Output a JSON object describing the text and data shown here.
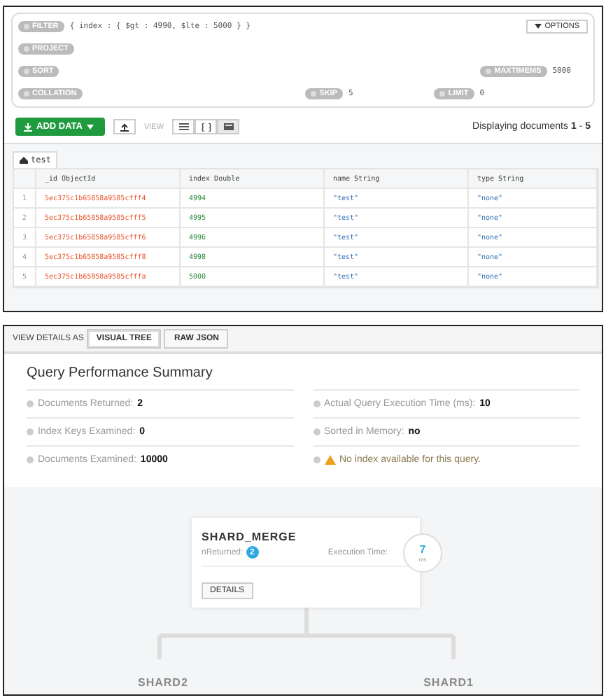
{
  "query": {
    "options": "OPTIONS",
    "filter": {
      "label": "FILTER",
      "value": "{ index : { $gt : 4990, $lte : 5000 } }"
    },
    "project": {
      "label": "PROJECT"
    },
    "sort": {
      "label": "SORT"
    },
    "maxtimems": {
      "label": "MAXTIMEMS",
      "value": "5000"
    },
    "collation": {
      "label": "COLLATION"
    },
    "skip": {
      "label": "SKIP",
      "value": "5"
    },
    "limit": {
      "label": "LIMIT",
      "value": "0"
    }
  },
  "toolbar": {
    "add": "ADD DATA",
    "view_label": "VIEW",
    "views": [
      {
        "kind": "list",
        "selected": false
      },
      {
        "kind": "json",
        "selected": false
      },
      {
        "kind": "table",
        "selected": true
      }
    ],
    "status": "Displaying documents **1** - **5**"
  },
  "tab": "test",
  "table": {
    "columns": [
      {
        "name": "_id",
        "type": "ObjectId",
        "kind": "objectid"
      },
      {
        "name": "index",
        "type": "Double",
        "kind": "number"
      },
      {
        "name": "name",
        "type": "String",
        "kind": "string"
      },
      {
        "name": "type",
        "type": "String",
        "kind": "string"
      }
    ],
    "rows": [
      {
        "n": "1",
        "cells": [
          "5ec375c1b65858a9585cfff4",
          "4994",
          "\"test\"",
          "\"none\""
        ]
      },
      {
        "n": "2",
        "cells": [
          "5ec375c1b65858a9585cfff5",
          "4995",
          "\"test\"",
          "\"none\""
        ]
      },
      {
        "n": "3",
        "cells": [
          "5ec375c1b65858a9585cfff6",
          "4996",
          "\"test\"",
          "\"none\""
        ]
      },
      {
        "n": "4",
        "cells": [
          "5ec375c1b65858a9585cfff8",
          "4998",
          "\"test\"",
          "\"none\""
        ]
      },
      {
        "n": "5",
        "cells": [
          "5ec375c1b65858a9585cfffa",
          "5000",
          "\"test\"",
          "\"none\""
        ]
      }
    ]
  },
  "view_details": {
    "label": "VIEW DETAILS AS",
    "tabs": [
      {
        "label": "VISUAL TREE",
        "selected": true
      },
      {
        "label": "RAW JSON",
        "selected": false
      }
    ]
  },
  "summary": {
    "title": "Query Performance Summary",
    "left": [
      {
        "kind": "stat",
        "label": "Documents Returned:",
        "value": "2"
      },
      {
        "kind": "stat",
        "label": "Index Keys Examined:",
        "value": "0"
      },
      {
        "kind": "stat",
        "label": "Documents Examined:",
        "value": "10000"
      }
    ],
    "right": [
      {
        "kind": "stat",
        "label": "Actual Query Execution Time (ms):",
        "value": "10"
      },
      {
        "kind": "stat",
        "label": "Sorted in Memory:",
        "value": "no"
      },
      {
        "kind": "warning",
        "label": "No index available for this query."
      }
    ]
  },
  "tree": {
    "stage": "SHARD_MERGE",
    "returned_label": "nReturned:",
    "returned": "2",
    "time_label": "Execution Time:",
    "time": "7",
    "time_unit": "ms",
    "details": "DETAILS",
    "children": [
      {
        "name": "SHARD2"
      },
      {
        "name": "SHARD1"
      }
    ]
  }
}
